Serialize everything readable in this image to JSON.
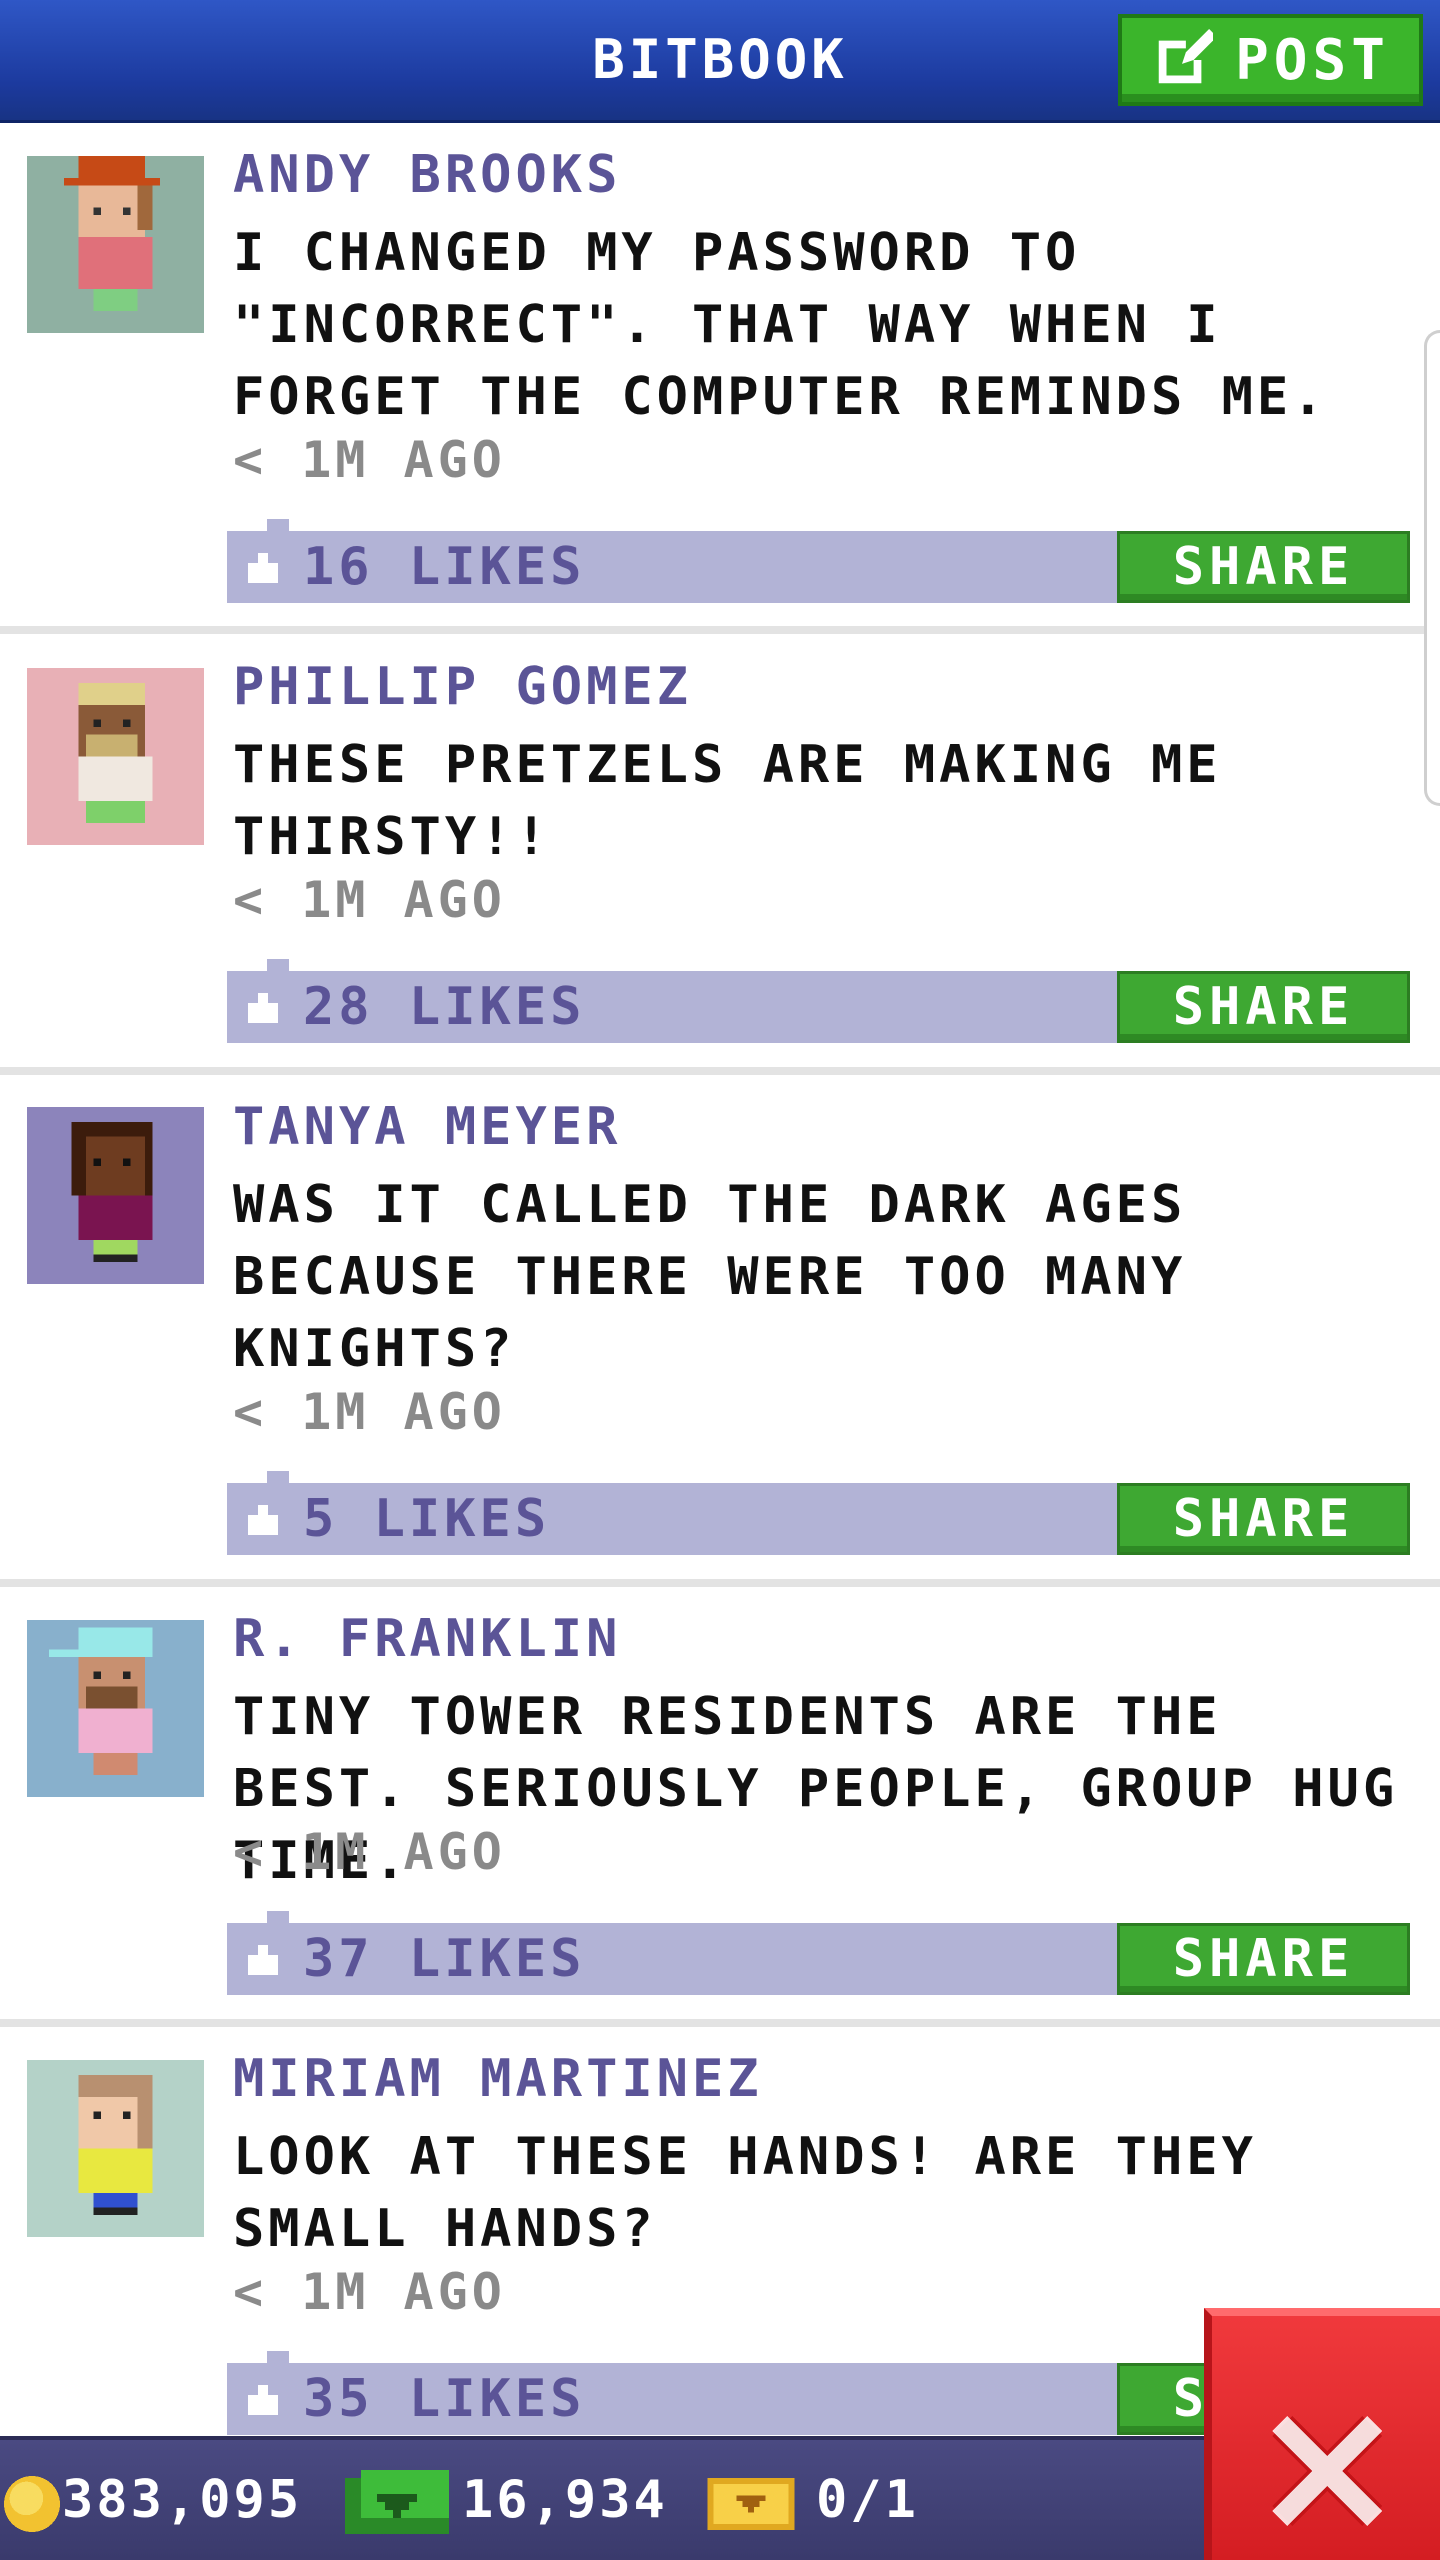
{
  "header": {
    "title": "BITBOOK",
    "post_label": "POST"
  },
  "posts": [
    {
      "author": "ANDY BROOKS",
      "text": "I CHANGED MY PASSWORD TO \"INCORRECT\". THAT WAY WHEN I FORGET THE COMPUTER REMINDS ME.",
      "time": "< 1M AGO",
      "likes": "16 LIKES",
      "share": "SHARE",
      "avatar_bg": "#8fb0a2"
    },
    {
      "author": "PHILLIP GOMEZ",
      "text": "THESE PRETZELS ARE MAKING ME THIRSTY!!",
      "time": "< 1M AGO",
      "likes": "28 LIKES",
      "share": "SHARE",
      "avatar_bg": "#e8b0b6"
    },
    {
      "author": "TANYA MEYER",
      "text": "WAS IT CALLED THE DARK AGES BECAUSE THERE WERE TOO MANY KNIGHTS?",
      "time": "< 1M AGO",
      "likes": "5 LIKES",
      "share": "SHARE",
      "avatar_bg": "#8c84bb"
    },
    {
      "author": "R. FRANKLIN",
      "text": "TINY TOWER RESIDENTS ARE THE BEST. SERIOUSLY PEOPLE, GROUP HUG TIME.",
      "time": "< 1M AGO",
      "likes": "37 LIKES",
      "share": "SHARE",
      "avatar_bg": "#88b0cc"
    },
    {
      "author": "MIRIAM MARTINEZ",
      "text": "LOOK AT THESE HANDS! ARE THEY SMALL HANDS?",
      "time": "< 1M AGO",
      "likes": "35 LIKES",
      "share": "SHARE",
      "avatar_bg": "#b4d2c8"
    }
  ],
  "bottom_bar": {
    "coins": "383,095",
    "bux": "16,934",
    "tickets": "0/1"
  },
  "colors": {
    "header_blue": "#1c3a9e",
    "accent_green": "#3ea832",
    "author_purple": "#5b5497",
    "likes_bar": "#b2b3d6",
    "close_red": "#e02a2e"
  }
}
